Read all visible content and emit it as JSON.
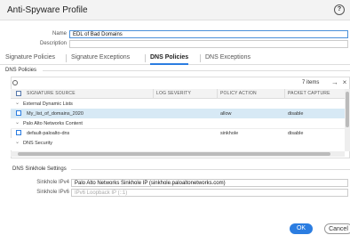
{
  "dialog": {
    "title": "Anti-Spyware Profile",
    "help_icon": "?"
  },
  "form": {
    "name_label": "Name",
    "name_value": "EDL of Bad Domains",
    "description_label": "Description",
    "description_value": ""
  },
  "tabs": [
    {
      "label": "Signature Policies"
    },
    {
      "label": "Signature Exceptions"
    },
    {
      "label": "DNS Policies"
    },
    {
      "label": "DNS Exceptions"
    }
  ],
  "dns_policies": {
    "section_title": "DNS Policies",
    "items_count": "7 items",
    "columns": [
      "SIGNATURE SOURCE",
      "LOG SEVERITY",
      "POLICY ACTION",
      "PACKET CAPTURE"
    ],
    "groups": [
      {
        "label": "External Dynamic Lists"
      },
      {
        "label": "Palo Alto Networks Content"
      },
      {
        "label": "DNS Security"
      }
    ],
    "rows": [
      {
        "source": "My_list_of_domains_2020",
        "severity": "",
        "action": "allow",
        "capture": "disable"
      },
      {
        "source": "default-paloalto-dns",
        "severity": "",
        "action": "sinkhole",
        "capture": "disable"
      }
    ]
  },
  "sinkhole": {
    "section_title": "DNS Sinkhole Settings",
    "ipv4_label": "Sinkhole IPv4",
    "ipv4_value": "Palo Alto Networks Sinkhole IP (sinkhole.paloaltonetworks.com)",
    "ipv6_label": "Sinkhole IPv6",
    "ipv6_value": "IPv6 Loopback IP (::1)"
  },
  "footer": {
    "ok": "OK",
    "cancel": "Cancel"
  }
}
